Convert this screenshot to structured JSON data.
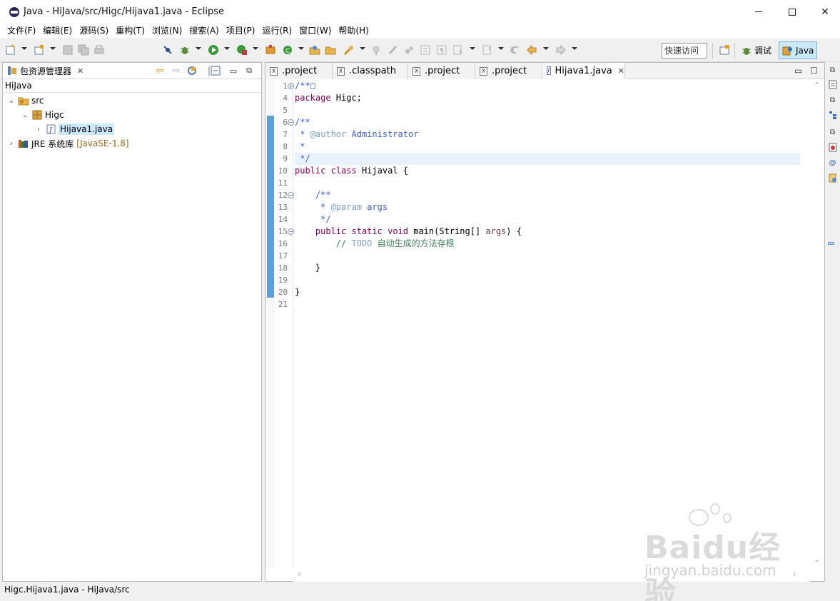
{
  "window": {
    "title": "Java  -  HiJava/src/Higc/Hijava1.java  -  Eclipse"
  },
  "menu": [
    "文件(F)",
    "编辑(E)",
    "源码(S)",
    "重构(T)",
    "浏览(N)",
    "搜索(A)",
    "项目(P)",
    "运行(R)",
    "窗口(W)",
    "帮助(H)"
  ],
  "toolbar": {
    "quick_access_placeholder": "快速访问",
    "perspectives": [
      {
        "label": "调试",
        "icon": "debug-bug-icon",
        "active": false
      },
      {
        "label": "Java",
        "icon": "java-perspective-icon",
        "active": true
      }
    ]
  },
  "package_explorer": {
    "tab_label": "包资源管理器",
    "breadcrumb": "HiJava",
    "tree": [
      {
        "label": "src",
        "icon": "source-folder-icon",
        "expanded": true
      },
      {
        "label": "Higc",
        "icon": "package-icon",
        "expanded": true
      },
      {
        "label": "Hijava1.java",
        "icon": "java-file-icon",
        "selected": true
      },
      {
        "label": "JRE 系统库",
        "suffix": "[JavaSE-1.8]",
        "icon": "library-icon",
        "expanded": false
      }
    ]
  },
  "editor": {
    "tabs": [
      {
        "label": ".project",
        "icon": "xml-file-icon"
      },
      {
        "label": ".classpath",
        "icon": "xml-file-icon"
      },
      {
        "label": ".project",
        "icon": "xml-file-icon"
      },
      {
        "label": ".project",
        "icon": "xml-file-icon"
      },
      {
        "label": "Hijava1.java",
        "icon": "java-file-icon",
        "active": true
      }
    ],
    "lines": [
      {
        "n": "1",
        "fold": "+",
        "parts": [
          {
            "t": "/**",
            "c": "cm"
          },
          {
            "t": "□",
            "c": "cm"
          }
        ]
      },
      {
        "n": "4",
        "parts": [
          {
            "t": "package",
            "c": "kw"
          },
          {
            "t": " Higc;",
            "c": ""
          }
        ]
      },
      {
        "n": "5",
        "parts": []
      },
      {
        "n": "6",
        "fold": "-",
        "parts": [
          {
            "t": "/**",
            "c": "cm"
          }
        ]
      },
      {
        "n": "7",
        "parts": [
          {
            "t": " * ",
            "c": "cm"
          },
          {
            "t": "@author",
            "c": "tag"
          },
          {
            "t": " Administrator",
            "c": "cm"
          }
        ]
      },
      {
        "n": "8",
        "parts": [
          {
            "t": " *",
            "c": "cm"
          }
        ]
      },
      {
        "n": "9",
        "current": true,
        "parts": [
          {
            "t": " */",
            "c": "cm"
          }
        ]
      },
      {
        "n": "10",
        "parts": [
          {
            "t": "public",
            "c": "kw"
          },
          {
            "t": " ",
            "c": ""
          },
          {
            "t": "class",
            "c": "kw"
          },
          {
            "t": " Hijaval {",
            "c": ""
          }
        ]
      },
      {
        "n": "11",
        "parts": []
      },
      {
        "n": "12",
        "fold": "-",
        "parts": [
          {
            "t": "    /**",
            "c": "cm"
          }
        ]
      },
      {
        "n": "13",
        "parts": [
          {
            "t": "     * ",
            "c": "cm"
          },
          {
            "t": "@param",
            "c": "tag"
          },
          {
            "t": " args",
            "c": "cm"
          }
        ]
      },
      {
        "n": "14",
        "parts": [
          {
            "t": "     */",
            "c": "cm"
          }
        ]
      },
      {
        "n": "15",
        "fold": "-",
        "parts": [
          {
            "t": "    ",
            "c": ""
          },
          {
            "t": "public",
            "c": "kw"
          },
          {
            "t": " ",
            "c": ""
          },
          {
            "t": "static",
            "c": "kw"
          },
          {
            "t": " ",
            "c": ""
          },
          {
            "t": "void",
            "c": "kw"
          },
          {
            "t": " main(String[] ",
            "c": ""
          },
          {
            "t": "args",
            "c": "param"
          },
          {
            "t": ") {",
            "c": ""
          }
        ]
      },
      {
        "n": "16",
        "parts": [
          {
            "t": "        // ",
            "c": "lc"
          },
          {
            "t": "TODO",
            "c": "todo"
          },
          {
            "t": " 自动生成的方法存根",
            "c": "lc"
          }
        ]
      },
      {
        "n": "17",
        "parts": []
      },
      {
        "n": "18",
        "parts": [
          {
            "t": "    }",
            "c": ""
          }
        ]
      },
      {
        "n": "19",
        "parts": []
      },
      {
        "n": "20",
        "parts": [
          {
            "t": "}",
            "c": ""
          }
        ]
      },
      {
        "n": "21",
        "parts": []
      }
    ]
  },
  "status": {
    "text": "Higc.Hijava1.java - HiJava/src"
  },
  "watermark": {
    "main": "Baidu经验",
    "sub": "jingyan.baidu.com"
  }
}
